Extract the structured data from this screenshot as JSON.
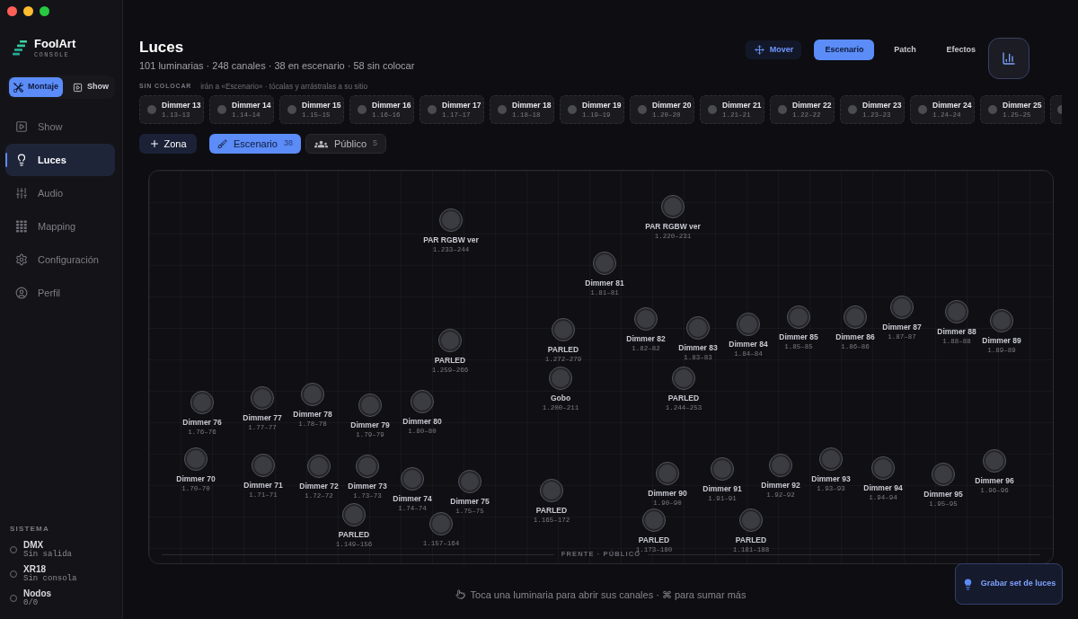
{
  "brand": {
    "name": "FoolArt",
    "subtitle": "CONSOLE"
  },
  "mode_switch": [
    {
      "label": "Montaje",
      "kind": "setup",
      "selected": true
    },
    {
      "label": "Show",
      "kind": "show",
      "selected": false
    }
  ],
  "sidebar": {
    "items": [
      {
        "label": "Show",
        "kind": "show",
        "selected": false
      },
      {
        "label": "Luces",
        "kind": "lights",
        "selected": true
      },
      {
        "label": "Audio",
        "kind": "audio",
        "selected": false
      },
      {
        "label": "Mapping",
        "kind": "mapping",
        "selected": false
      },
      {
        "label": "Configuración",
        "kind": "settings",
        "selected": false
      },
      {
        "label": "Perfil",
        "kind": "profile",
        "selected": false
      }
    ]
  },
  "system": {
    "title": "SISTEMA",
    "items": [
      {
        "name": "DMX",
        "status": "Sin salida"
      },
      {
        "name": "XR18",
        "status": "Sin consola"
      },
      {
        "name": "Nodos",
        "status": "0/0"
      }
    ]
  },
  "header": {
    "title": "Luces",
    "summary": "101 luminarias · 248 canales · 38 en escenario · 58 sin colocar"
  },
  "toolbar": {
    "move_button": "Mover",
    "tabs": [
      {
        "label": "Escenario",
        "selected": true
      },
      {
        "label": "Patch",
        "selected": false
      },
      {
        "label": "Efectos",
        "selected": false
      }
    ]
  },
  "unplaced": {
    "title": "SIN COLOCAR",
    "hint": "irán a «Escenario» · tócalas y arrástralas a su sitio",
    "fixtures": [
      {
        "name": "Dimmer 13",
        "address": "1.13–13"
      },
      {
        "name": "Dimmer 14",
        "address": "1.14–14"
      },
      {
        "name": "Dimmer 15",
        "address": "1.15–15"
      },
      {
        "name": "Dimmer 16",
        "address": "1.16–16"
      },
      {
        "name": "Dimmer 17",
        "address": "1.17–17"
      },
      {
        "name": "Dimmer 18",
        "address": "1.18–18"
      },
      {
        "name": "Dimmer 19",
        "address": "1.19–19"
      },
      {
        "name": "Dimmer 20",
        "address": "1.20–20"
      },
      {
        "name": "Dimmer 21",
        "address": "1.21–21"
      },
      {
        "name": "Dimmer 22",
        "address": "1.22–22"
      },
      {
        "name": "Dimmer 23",
        "address": "1.23–23"
      },
      {
        "name": "Dimmer 24",
        "address": "1.24–24"
      },
      {
        "name": "Dimmer 25",
        "address": "1.25–25"
      }
    ]
  },
  "zones": {
    "add_button": "Zona",
    "tabs": [
      {
        "label": "Escenario",
        "count": "38",
        "kind": "stage",
        "selected": true
      },
      {
        "label": "Público",
        "count": "5",
        "kind": "audience",
        "selected": false
      }
    ]
  },
  "stage": {
    "fixtures": [
      {
        "name": "PAR RGBW ver",
        "address": "1.233–244"
      },
      {
        "name": "PAR RGBW ver",
        "address": "1.220–231"
      },
      {
        "name": "Dimmer 81",
        "address": "1.81–81"
      },
      {
        "name": "PARLED",
        "address": "1.259–266"
      },
      {
        "name": "PARLED",
        "address": "1.272–279"
      },
      {
        "name": "Dimmer 82",
        "address": "1.82–82"
      },
      {
        "name": "Dimmer 83",
        "address": "1.83–83"
      },
      {
        "name": "Dimmer 84",
        "address": "1.84–84"
      },
      {
        "name": "Dimmer 85",
        "address": "1.85–85"
      },
      {
        "name": "Dimmer 86",
        "address": "1.86–86"
      },
      {
        "name": "Dimmer 87",
        "address": "1.87–87"
      },
      {
        "name": "Dimmer 88",
        "address": "1.88–88"
      },
      {
        "name": "Dimmer 89",
        "address": "1.89–89"
      },
      {
        "name": "Dimmer 76",
        "address": "1.76–76"
      },
      {
        "name": "Dimmer 77",
        "address": "1.77–77"
      },
      {
        "name": "Dimmer 78",
        "address": "1.78–78"
      },
      {
        "name": "Dimmer 79",
        "address": "1.79–79"
      },
      {
        "name": "Dimmer 80",
        "address": "1.80–80"
      },
      {
        "name": "Gobo",
        "address": "1.200–211"
      },
      {
        "name": "PARLED",
        "address": "1.244–253"
      },
      {
        "name": "Dimmer 70",
        "address": "1.70–70"
      },
      {
        "name": "Dimmer 71",
        "address": "1.71–71"
      },
      {
        "name": "Dimmer 72",
        "address": "1.72–72"
      },
      {
        "name": "Dimmer 73",
        "address": "1.73–73"
      },
      {
        "name": "Dimmer 74",
        "address": "1.74–74"
      },
      {
        "name": "Dimmer 75",
        "address": "1.75–75"
      },
      {
        "name": "PARLED",
        "address": "1.165–172"
      },
      {
        "name": "Dimmer 90",
        "address": "1.90–90"
      },
      {
        "name": "Dimmer 91",
        "address": "1.91–91"
      },
      {
        "name": "Dimmer 92",
        "address": "1.92–92"
      },
      {
        "name": "Dimmer 93",
        "address": "1.93–93"
      },
      {
        "name": "Dimmer 94",
        "address": "1.94–94"
      },
      {
        "name": "Dimmer 95",
        "address": "1.95–95"
      },
      {
        "name": "Dimmer 96",
        "address": "1.96–96"
      },
      {
        "name": "PARLED",
        "address": "1.149–156"
      },
      {
        "address": "1.157–164"
      },
      {
        "name": "PARLED",
        "address": "1.173–180"
      },
      {
        "name": "PARLED",
        "address": "1.181–188"
      }
    ],
    "front_label": "FRENTE · PÚBLICO"
  },
  "hint": "Toca una luminaria para abrir sus canales · ⌘ para sumar más",
  "record_button": "Grabar set de luces"
}
